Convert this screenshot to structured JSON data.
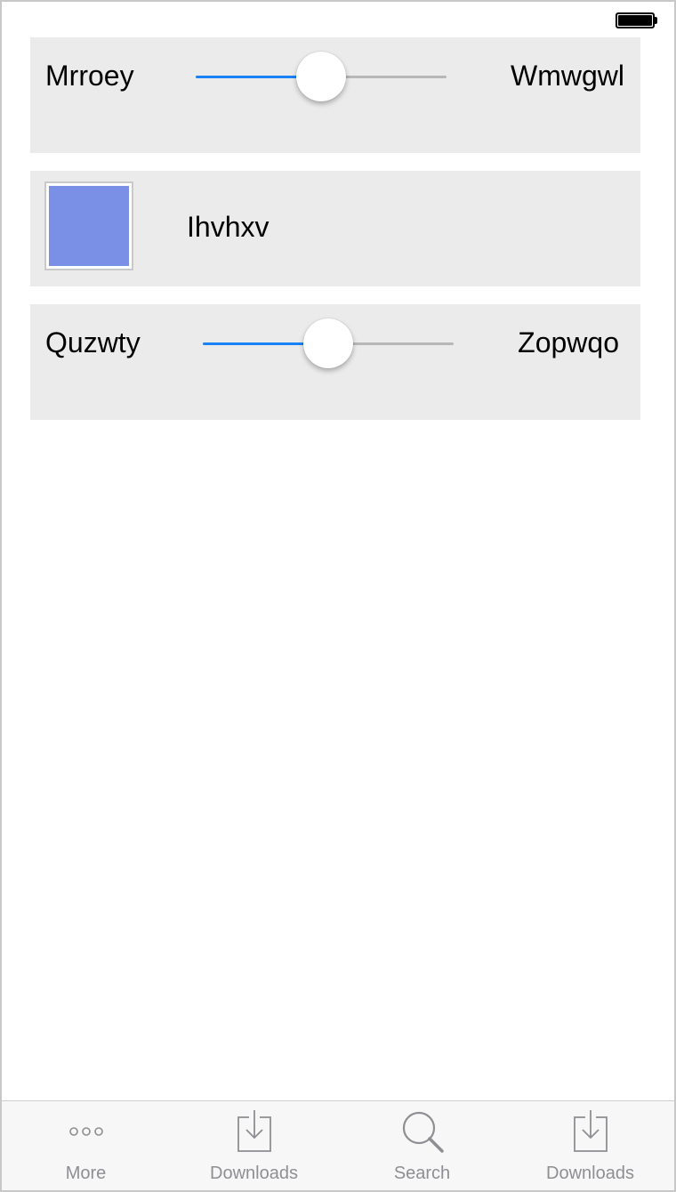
{
  "status_bar": {
    "battery_level": 1.0
  },
  "rows": [
    {
      "type": "slider",
      "left_label": "Mrroey",
      "right_label": "Wmwgwl",
      "value": 0.5,
      "accent": "#1a82f4"
    },
    {
      "type": "color",
      "swatch_color": "#7a8fe6",
      "label": "Ihvhxv"
    },
    {
      "type": "slider",
      "left_label": "Quzwty",
      "right_label": "Zopwqo",
      "value": 0.5,
      "accent": "#1a82f4"
    }
  ],
  "tab_bar": {
    "tabs": [
      {
        "icon": "more-icon",
        "label": "More"
      },
      {
        "icon": "download-icon",
        "label": "Downloads"
      },
      {
        "icon": "search-icon",
        "label": "Search"
      },
      {
        "icon": "download-icon",
        "label": "Downloads"
      }
    ],
    "icon_color": "#8e8e93"
  }
}
